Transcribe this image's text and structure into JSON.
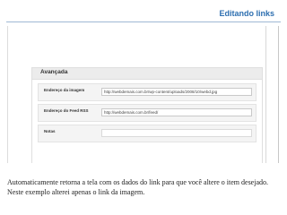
{
  "slide": {
    "title": "Editando links",
    "caption": "Automaticamente retorna a tela com os dados do link para que você altere o item desejado. Neste exemplo alterei apenas o link da imagem."
  },
  "panel": {
    "header": "Avançada",
    "rows": [
      {
        "label": "Endereço da imagem",
        "value": "http://webdemais.com.br/wp-content/uploads/2008/10/webd.jpg"
      },
      {
        "label": "Endereço do Feed RSS",
        "value": "http://webdemais.com.br/feed/"
      },
      {
        "label": "Notas",
        "value": ""
      }
    ]
  }
}
